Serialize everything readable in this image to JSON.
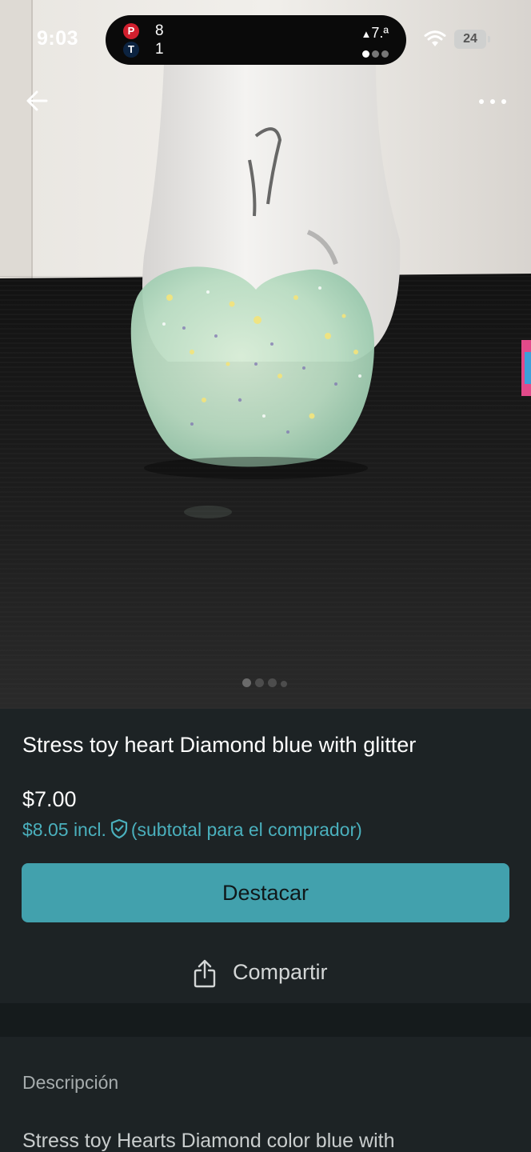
{
  "status_bar": {
    "time": "9:03",
    "live_activity": {
      "team_a_score": "8",
      "team_b_score": "1",
      "inning": "7.ª",
      "team_a_icon": "phillies-logo-icon",
      "team_b_icon": "twins-logo-icon"
    },
    "battery": "24"
  },
  "nav": {
    "back_icon": "arrow-left-icon",
    "more_icon": "more-horizontal-icon"
  },
  "carousel": {
    "photo_count": 4,
    "active_index": 0
  },
  "product": {
    "title": "Stress toy heart Diamond blue with glitter",
    "price": "$7.00",
    "price_incl": "$8.05 incl.",
    "price_incl_note": "(subtotal para el comprador)"
  },
  "actions": {
    "boost_label": "Destacar",
    "share_label": "Compartir"
  },
  "description": {
    "heading": "Descripción",
    "body": "Stress toy Hearts Diamond color blue with"
  },
  "colors": {
    "accent": "#42a1ad",
    "accent_text": "#4ab0bd",
    "background": "#1d2325"
  }
}
